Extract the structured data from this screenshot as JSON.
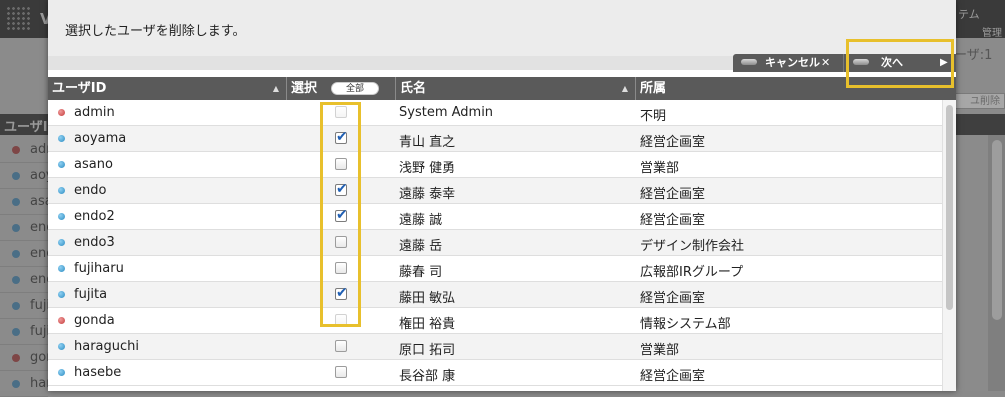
{
  "background": {
    "title_fragment": "V",
    "system_fragment": "テム",
    "admin_fragment": "管理",
    "user_count": "ーザ:1",
    "delete_fragment": "ユ削除",
    "header_label": "ユーザI",
    "rows": [
      {
        "uname": "adr",
        "status": "red"
      },
      {
        "uname": "aoy",
        "status": "blue"
      },
      {
        "uname": "asa",
        "status": "blue"
      },
      {
        "uname": "enc",
        "status": "blue"
      },
      {
        "uname": "enc",
        "status": "blue"
      },
      {
        "uname": "enc",
        "status": "blue"
      },
      {
        "uname": "fuji",
        "status": "blue"
      },
      {
        "uname": "fuji",
        "status": "blue"
      },
      {
        "uname": "gor",
        "status": "red"
      },
      {
        "uname": "har",
        "status": "blue"
      }
    ]
  },
  "dialog": {
    "message": "選択したユーザを削除します。",
    "buttons": {
      "cancel_label": "キャンセル",
      "cancel_icon": "close-icon",
      "next_label": "次へ",
      "next_icon": "arrow-right-icon"
    },
    "table": {
      "headers": {
        "user_id": "ユーザID",
        "select": "選択",
        "select_all": "全部",
        "name": "氏名",
        "department": "所属"
      },
      "rows": [
        {
          "user_id": "admin",
          "status": "red",
          "checked": false,
          "disabled": true,
          "name": "System Admin",
          "department": "不明"
        },
        {
          "user_id": "aoyama",
          "status": "blue",
          "checked": true,
          "disabled": false,
          "name": "青山 直之",
          "department": "経営企画室"
        },
        {
          "user_id": "asano",
          "status": "blue",
          "checked": false,
          "disabled": false,
          "name": "浅野 健勇",
          "department": "営業部"
        },
        {
          "user_id": "endo",
          "status": "blue",
          "checked": true,
          "disabled": false,
          "name": "遠藤 泰幸",
          "department": "経営企画室"
        },
        {
          "user_id": "endo2",
          "status": "blue",
          "checked": true,
          "disabled": false,
          "name": "遠藤 誠",
          "department": "経営企画室"
        },
        {
          "user_id": "endo3",
          "status": "blue",
          "checked": false,
          "disabled": false,
          "name": "遠藤 岳",
          "department": "デザイン制作会社"
        },
        {
          "user_id": "fujiharu",
          "status": "blue",
          "checked": false,
          "disabled": false,
          "name": "藤春 司",
          "department": "広報部IRグループ"
        },
        {
          "user_id": "fujita",
          "status": "blue",
          "checked": true,
          "disabled": false,
          "name": "藤田 敏弘",
          "department": "経営企画室"
        },
        {
          "user_id": "gonda",
          "status": "red",
          "checked": false,
          "disabled": true,
          "name": "権田 裕貴",
          "department": "情報システム部"
        },
        {
          "user_id": "haraguchi",
          "status": "blue",
          "checked": false,
          "disabled": false,
          "name": "原口 拓司",
          "department": "営業部"
        },
        {
          "user_id": "hasebe",
          "status": "blue",
          "checked": false,
          "disabled": false,
          "name": "長谷部 康",
          "department": "経営企画室"
        }
      ]
    }
  },
  "colors": {
    "header_bg": "#5a5a5a",
    "highlight": "#e8c02c",
    "status_blue": "#2c8cc2",
    "status_red": "#c43c3c",
    "check_blue": "#1f5fb4"
  }
}
